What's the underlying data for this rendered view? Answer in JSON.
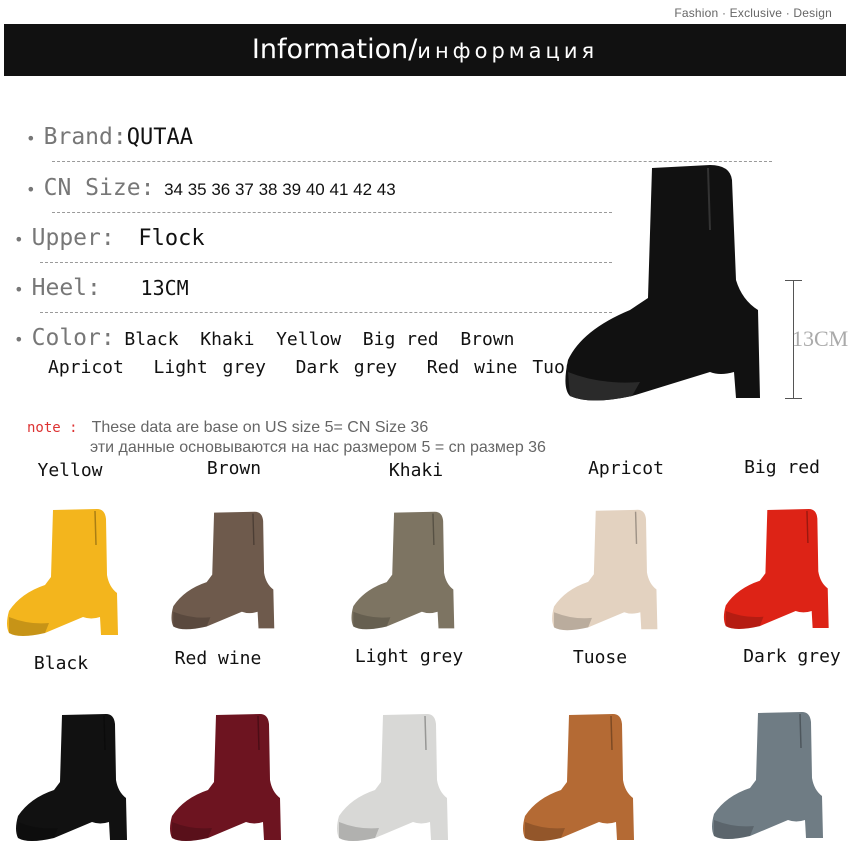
{
  "header": {
    "tagline": "Fashion · Exclusive · Design",
    "title_en": "Information/",
    "title_ru": "информация"
  },
  "specs": {
    "brand_label": "Brand:",
    "brand_value": "QUTAA",
    "size_label": "CN Size:",
    "size_value": "34 35 36 37 38 39 40 41 42 43",
    "upper_label": "Upper:",
    "upper_value": "Flock",
    "heel_label": "Heel:",
    "heel_value": "13CM",
    "color_label": "Color:",
    "color_value_line1": "Black  Khaki  Yellow  Big red  Brown",
    "color_value_line2": "Apricot  Light grey  Dark grey  Red wine Tuose"
  },
  "measure": {
    "label": "13CM"
  },
  "note": {
    "label": "note :",
    "text_en": "These data are base on US size 5= CN Size 36",
    "text_ru": "эти данные основываются на нас размером 5 = cn размер 36"
  },
  "swatches_row1": [
    {
      "label": "Yellow",
      "color": "#f3b51d"
    },
    {
      "label": "Brown",
      "color": "#6e5a4c"
    },
    {
      "label": "Khaki",
      "color": "#7d7462"
    },
    {
      "label": "Apricot",
      "color": "#e3d2c0"
    },
    {
      "label": "Big red",
      "color": "#dd2316"
    }
  ],
  "swatches_row2": [
    {
      "label": "Black",
      "color": "#111111"
    },
    {
      "label": "Red wine",
      "color": "#6d1420"
    },
    {
      "label": "Light grey",
      "color": "#d8d8d6"
    },
    {
      "label": "Tuose",
      "color": "#b46a34"
    },
    {
      "label": "Dark grey",
      "color": "#6f7c84"
    }
  ]
}
